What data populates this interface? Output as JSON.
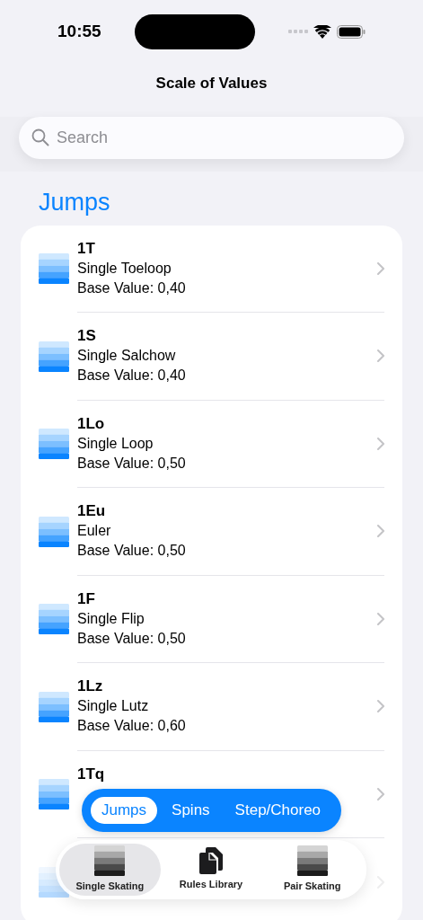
{
  "status_bar": {
    "time": "10:55"
  },
  "nav": {
    "title": "Scale of Values"
  },
  "search": {
    "placeholder": "Search"
  },
  "section": {
    "title": "Jumps"
  },
  "elements": [
    {
      "code": "1T",
      "name": "Single Toeloop",
      "base_value": "Base Value: 0,40"
    },
    {
      "code": "1S",
      "name": "Single Salchow",
      "base_value": "Base Value: 0,40"
    },
    {
      "code": "1Lo",
      "name": "Single Loop",
      "base_value": "Base Value: 0,50"
    },
    {
      "code": "1Eu",
      "name": "Euler",
      "base_value": "Base Value: 0,50"
    },
    {
      "code": "1F",
      "name": "Single Flip",
      "base_value": "Base Value: 0,50"
    },
    {
      "code": "1Lz",
      "name": "Single Lutz",
      "base_value": "Base Value: 0,60"
    },
    {
      "code": "1Tq"
    }
  ],
  "segments": [
    {
      "label": "Jumps",
      "selected": true
    },
    {
      "label": "Spins",
      "selected": false
    },
    {
      "label": "Step/Choreo",
      "selected": false
    }
  ],
  "tab_bar": [
    {
      "label": "Single Skating",
      "kind": "scale",
      "selected": true
    },
    {
      "label": "Rules Library",
      "kind": "documents",
      "selected": false
    },
    {
      "label": "Pair Skating",
      "kind": "scale",
      "selected": false
    }
  ]
}
